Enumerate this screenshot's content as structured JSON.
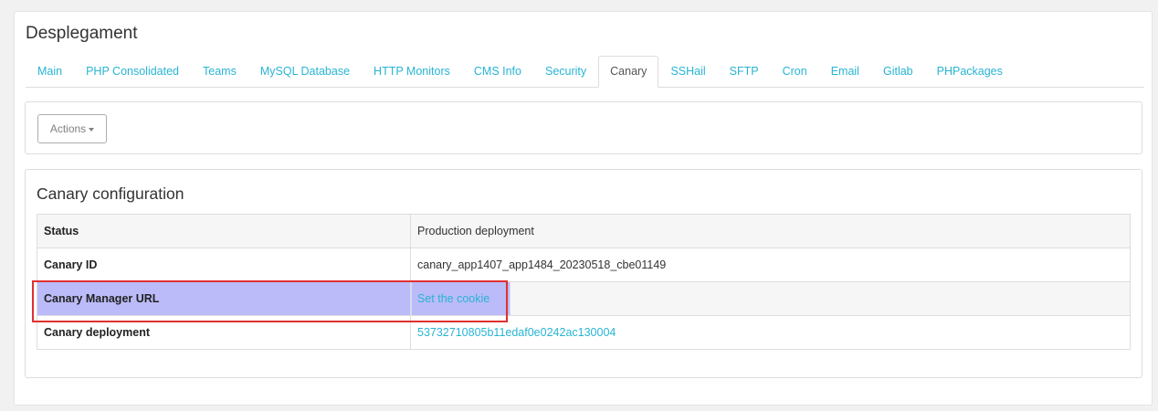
{
  "panel": {
    "title": "Desplegament"
  },
  "tabs": [
    {
      "label": "Main",
      "active": false
    },
    {
      "label": "PHP Consolidated",
      "active": false
    },
    {
      "label": "Teams",
      "active": false
    },
    {
      "label": "MySQL Database",
      "active": false
    },
    {
      "label": "HTTP Monitors",
      "active": false
    },
    {
      "label": "CMS Info",
      "active": false
    },
    {
      "label": "Security",
      "active": false
    },
    {
      "label": "Canary",
      "active": true
    },
    {
      "label": "SSHail",
      "active": false
    },
    {
      "label": "SFTP",
      "active": false
    },
    {
      "label": "Cron",
      "active": false
    },
    {
      "label": "Email",
      "active": false
    },
    {
      "label": "Gitlab",
      "active": false
    },
    {
      "label": "PHPackages",
      "active": false
    }
  ],
  "actions": {
    "label": "Actions",
    "icon": "caret-down-icon"
  },
  "config": {
    "title": "Canary configuration",
    "rows": [
      {
        "key": "Status",
        "value": "Production deployment"
      },
      {
        "key": "Canary ID",
        "value": "canary_app1407_app1484_20230518_cbe01149"
      },
      {
        "key": "Canary Manager URL",
        "value": "Set the cookie"
      },
      {
        "key": "Canary deployment",
        "value": "53732710805b11edaf0e0242ac130004"
      }
    ]
  },
  "colors": {
    "link": "#28b4d4",
    "highlight_fill": "#bbbbf9",
    "highlight_border": "#e03030"
  }
}
